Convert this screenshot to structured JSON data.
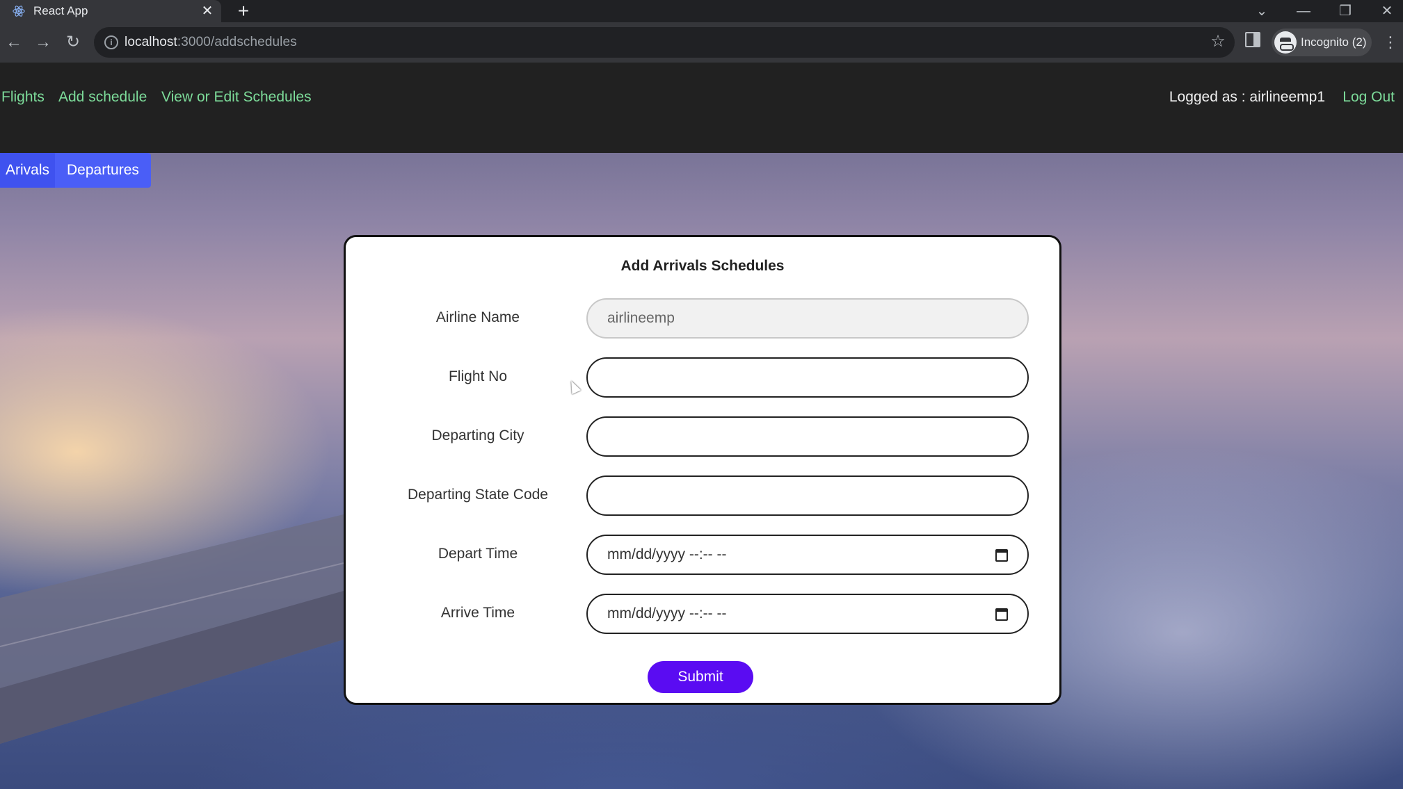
{
  "browser": {
    "tab_title": "React App",
    "tab_close": "✕",
    "new_tab": "+",
    "url_host": "localhost",
    "url_path": ":3000/addschedules",
    "incognito_label": "Incognito (2)",
    "window_controls": [
      "⌄",
      "—",
      "❐",
      "✕"
    ],
    "nav_icons": {
      "back": "←",
      "forward": "→",
      "reload": "↻",
      "star": "☆",
      "menu": "⋮",
      "info": "i"
    }
  },
  "nav": {
    "links": [
      "Flights",
      "Add schedule",
      "View or Edit Schedules"
    ],
    "user_text": "Logged as : airlineemp1",
    "logout": "Log Out"
  },
  "tabs": [
    "Arivals",
    "Departures"
  ],
  "form": {
    "title": "Add Arrivals Schedules",
    "fields": [
      {
        "label": "Airline Name",
        "value": "airlineemp",
        "disabled": true
      },
      {
        "label": "Flight No",
        "value": ""
      },
      {
        "label": "Departing City",
        "value": ""
      },
      {
        "label": "Departing State Code",
        "value": ""
      },
      {
        "label": "Depart Time",
        "value": "mm/dd/yyyy --:-- --"
      },
      {
        "label": "Arrive Time",
        "value": "mm/dd/yyyy --:-- --"
      }
    ],
    "submit": "Submit"
  }
}
